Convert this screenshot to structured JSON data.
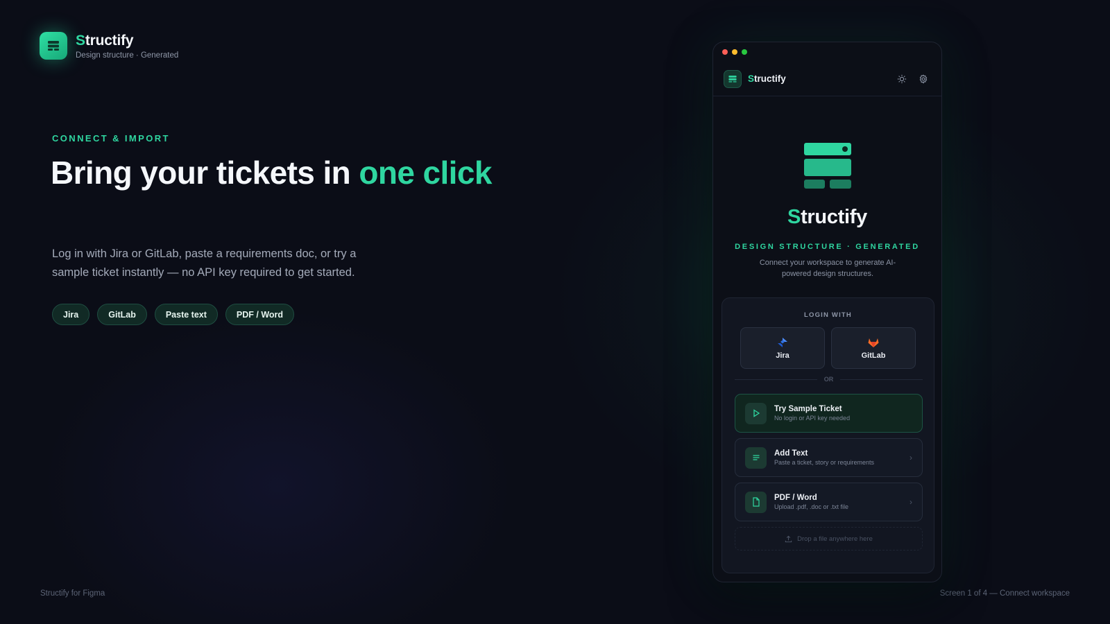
{
  "brand": {
    "name_initial": "S",
    "name_rest": "tructify",
    "tagline": "Design structure · Generated"
  },
  "hero": {
    "eyebrow": "CONNECT & IMPORT",
    "headline_main": "Bring your tickets in ",
    "headline_accent": "one click",
    "subtext": "Log in with Jira or GitLab, paste a requirements doc, or try a sample ticket instantly — no API key required to get started.",
    "chips": [
      "Jira",
      "GitLab",
      "Paste text",
      "PDF / Word"
    ]
  },
  "plugin": {
    "header": {
      "name_initial": "S",
      "name_rest": "tructify",
      "icons": [
        "sun-icon",
        "settings-icon"
      ]
    },
    "hero": {
      "name_initial": "S",
      "name_rest": "tructify",
      "tagline": "DESIGN STRUCTURE · GENERATED",
      "description": "Connect your workspace to generate AI-powered design structures."
    },
    "login": {
      "label": "LOGIN WITH",
      "providers": [
        {
          "name": "Jira",
          "icon": "jira-icon"
        },
        {
          "name": "GitLab",
          "icon": "gitlab-icon"
        }
      ],
      "divider": "OR"
    },
    "options": [
      {
        "title": "Try Sample Ticket",
        "subtitle": "No login or API key needed",
        "icon": "play-icon"
      },
      {
        "title": "Add Text",
        "subtitle": "Paste a ticket, story or requirements",
        "icon": "text-lines-icon"
      },
      {
        "title": "PDF / Word",
        "subtitle": "Upload .pdf, .doc or .txt file",
        "icon": "document-icon"
      }
    ],
    "drop_zone": "Drop a file anywhere here"
  },
  "footer": {
    "left": "Structify for Figma",
    "right": "Screen 1 of 4 — Connect workspace"
  },
  "colors": {
    "accent": "#2fd6a0",
    "background": "#0b0d17",
    "panel": "#121621"
  }
}
